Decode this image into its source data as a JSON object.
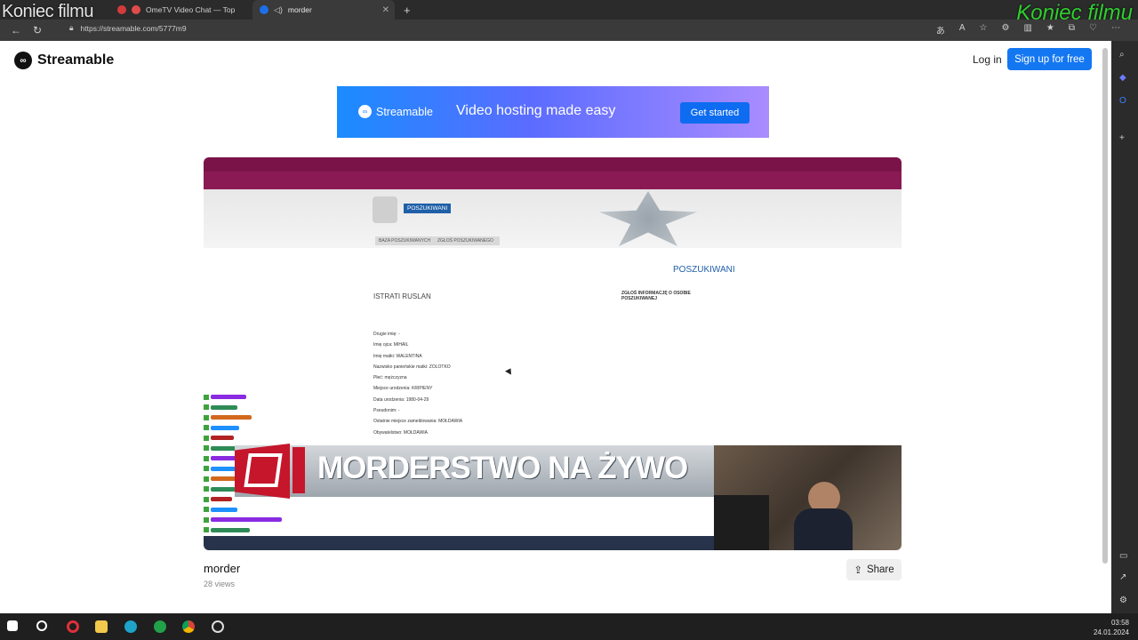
{
  "overlays": {
    "top_left_watermark": "Koniec filmu",
    "top_right_watermark": "Koniec filmu",
    "top_right_color": "#2fcf2f"
  },
  "tabs": [
    {
      "label": "OmeTV Video Chat — Top"
    },
    {
      "label": "morder"
    }
  ],
  "address_bar": {
    "url": "https://streamable.com/5777m9"
  },
  "header": {
    "logo": "Streamable",
    "login": "Log in",
    "signup": "Sign up for free",
    "accent": "#1477f2"
  },
  "banner": {
    "logo": "Streamable",
    "tagline": "Video hosting made easy",
    "cta": "Get started"
  },
  "video_content": {
    "page_badge": "POSZUKIWANI",
    "page_heading": "ISTRATI RUSLAN",
    "right_heading": "POSZUKIWANI",
    "side_heading": "ZGŁOŚ INFORMACJĘ O OSOBIE POSZUKIWANEJ",
    "overlay_title": "MORDERSTWO NA ŻYWO",
    "nav_tab_1": "BAZA POSZUKIWANYCH",
    "nav_tab_2": "ZGŁOŚ POSZUKIWANEGO",
    "fields": [
      "Drugie imię: -",
      "Imię ojca: MIHAIL",
      "Imię matki: WALENTINA",
      "Nazwisko panieńskie matki: ZOLOTKO",
      "Płeć: mężczyzna",
      "Miejsce urodzenia: KRIPIENY",
      "Data urodzenia: 1980-04-29",
      "Pseudonim: -",
      "Ostatnie miejsce zameldowania: MOŁDAWIA",
      "Obywatelstwo: MOŁDAWIA"
    ]
  },
  "video_meta": {
    "title": "morder",
    "views": "28 views",
    "share": "Share"
  },
  "taskbar": {
    "time": "03:58",
    "date": "24.01.2024"
  }
}
